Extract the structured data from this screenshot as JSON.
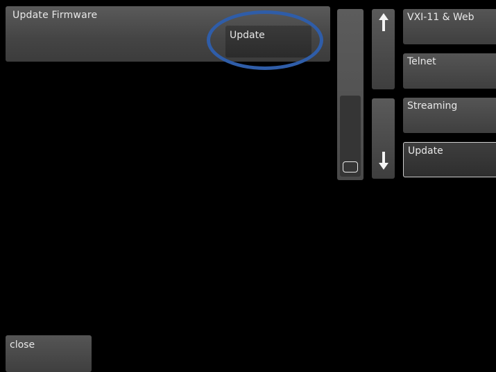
{
  "firmware_panel": {
    "title": "Update Firmware",
    "update_button_label": "Update"
  },
  "scroll": {
    "up_icon": "arrow-up-icon",
    "down_icon": "arrow-down-icon",
    "up_glyph": "⭡",
    "down_glyph": "⭣"
  },
  "menu": {
    "items": [
      {
        "label": "VXI-11 & Web"
      },
      {
        "label": "Telnet"
      },
      {
        "label": "Streaming"
      },
      {
        "label": "Update"
      }
    ],
    "active_index": 3
  },
  "footer": {
    "close_label": "close"
  },
  "colors": {
    "background": "#000000",
    "panel": "#4a4a4a",
    "highlight_ring": "#2f5da8",
    "text": "#e8e8e8"
  }
}
